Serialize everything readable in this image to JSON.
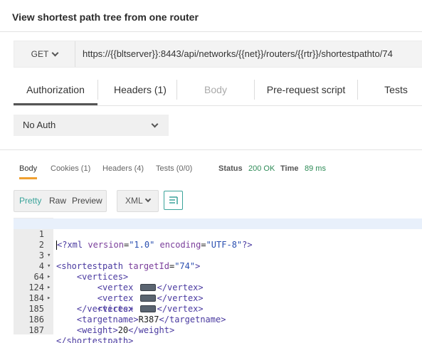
{
  "page": {
    "title": "View shortest path tree from one router"
  },
  "request": {
    "method": "GET",
    "url": "https://{{bltserver}}:8443/api/networks/{{net}}/routers/{{rtr}}/shortestpathto/74"
  },
  "request_tabs": [
    {
      "label": "Authorization",
      "state": "active"
    },
    {
      "label": "Headers (1)",
      "state": "normal"
    },
    {
      "label": "Body",
      "state": "disabled"
    },
    {
      "label": "Pre-request script",
      "state": "normal"
    },
    {
      "label": "Tests",
      "state": "normal"
    }
  ],
  "auth": {
    "selected": "No Auth"
  },
  "response": {
    "tabs": [
      {
        "label": "Body",
        "state": "active"
      },
      {
        "label": "Cookies (1)",
        "state": "normal"
      },
      {
        "label": "Headers (4)",
        "state": "normal"
      },
      {
        "label": "Tests (0/0)",
        "state": "normal"
      }
    ],
    "status_label": "Status",
    "status_value": "200 OK",
    "time_label": "Time",
    "time_value": "89 ms",
    "view_modes": [
      "Pretty",
      "Raw",
      "Preview"
    ],
    "active_view_mode": "Pretty",
    "format": "XML"
  },
  "editor": {
    "lines": [
      {
        "num": "1",
        "fold": "",
        "xml_decl": {
          "open": "?xml",
          "a1": "version",
          "v1": "\"1.0\"",
          "a2": "encoding",
          "v2": "\"UTF-8\"",
          "close": "?>"
        }
      },
      {
        "num": "2",
        "fold": "▾",
        "open_tag": "<shortestpath",
        "attr": "targetId",
        "value": "\"74\"",
        "close": ">"
      },
      {
        "num": "3",
        "fold": "▾",
        "text": "<vertices>"
      },
      {
        "num": "4",
        "fold": "▸",
        "vertex_open": "<vertex",
        "vertex_close": "</vertex>"
      },
      {
        "num": "64",
        "fold": "▸",
        "vertex_open": "<vertex",
        "vertex_close": "</vertex>"
      },
      {
        "num": "124",
        "fold": "▸",
        "vertex_open": "<vertex",
        "vertex_close": "</vertex>"
      },
      {
        "num": "184",
        "fold": "",
        "text": "</vertices>"
      },
      {
        "num": "185",
        "fold": "",
        "el_open": "<targetname>",
        "el_text": "R387",
        "el_close": "</targetname>"
      },
      {
        "num": "186",
        "fold": "",
        "el_open": "<weight>",
        "el_text": "20",
        "el_close": "</weight>"
      },
      {
        "num": "187",
        "fold": "",
        "text": "</shortestpath>"
      }
    ]
  }
}
